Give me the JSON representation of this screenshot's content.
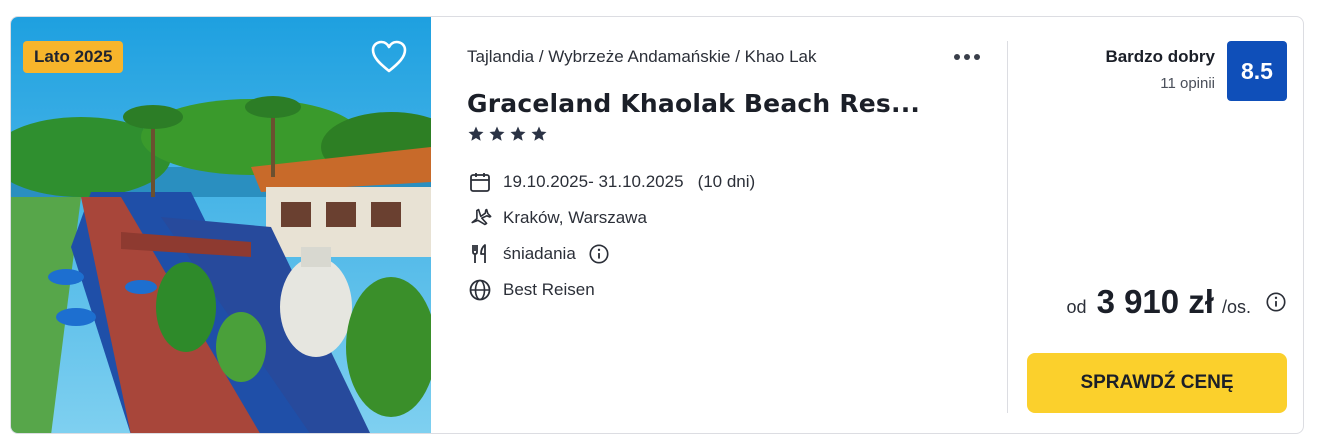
{
  "offer": {
    "season_badge": "Lato 2025",
    "breadcrumb": "Tajlandia / Wybrzeże Andamańskie / Khao Lak",
    "hotel_name": "Graceland Khaolak Beach Res...",
    "stars": 4,
    "dates": "19.10.2025- 31.10.2025",
    "duration": "(10 dni)",
    "departure": "Kraków, Warszawa",
    "board": "śniadania",
    "operator": "Best Reisen",
    "rating_label": "Bardzo dobry",
    "reviews": "11 opinii",
    "score": "8.5",
    "price_prefix": "od",
    "price": "3 910 zł",
    "price_suffix": "/os.",
    "cta_label": "SPRAWDŹ CENĘ"
  },
  "colors": {
    "badge": "#f7b52b",
    "score_bg": "#0f4fb9",
    "cta_bg": "#fbd02c"
  },
  "icons": [
    "heart-icon",
    "more-dots-icon",
    "star-icon",
    "calendar-icon",
    "plane-icon",
    "cutlery-icon",
    "info-icon",
    "globe-icon"
  ]
}
